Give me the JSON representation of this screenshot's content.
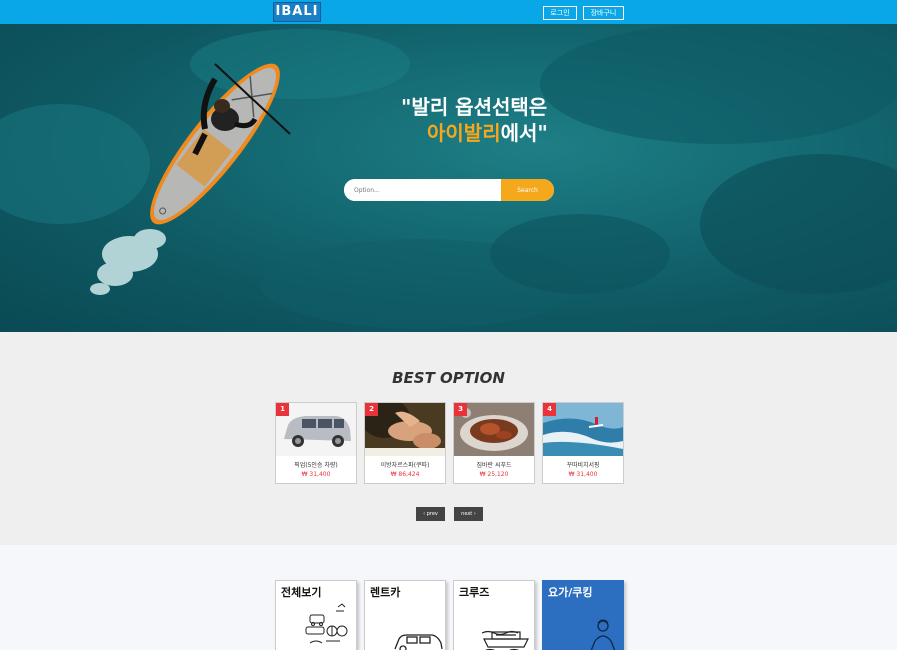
{
  "header": {
    "logo": "IBALI",
    "login_label": "로그인",
    "cart_label": "장바구니",
    "bar_color": "#0aa7e8"
  },
  "hero": {
    "line1": "\"발리 옵션선택은",
    "line2_highlight": "아이발리",
    "line2_rest": "에서\"",
    "highlight_color": "#f6a81c",
    "search": {
      "placeholder": "Option...",
      "button_label": "Search"
    }
  },
  "best": {
    "title": "BEST OPTION",
    "items": [
      {
        "rank": "1",
        "name": "픽업(5인승 차량)",
        "price": "₩ 31,400"
      },
      {
        "rank": "2",
        "name": "이방자르스파(쿠따)",
        "price": "₩ 86,424"
      },
      {
        "rank": "3",
        "name": "짐바란 씨푸드",
        "price": "₩ 25,120"
      },
      {
        "rank": "4",
        "name": "꾸따비치서핑",
        "price": "₩ 31,400"
      }
    ],
    "prev_label": "‹ prev",
    "next_label": "next ›"
  },
  "categories": [
    {
      "label": "전체보기",
      "icon": "vehicles-collage-icon"
    },
    {
      "label": "렌트카",
      "icon": "car-icon"
    },
    {
      "label": "크루즈",
      "icon": "cruise-ship-icon"
    },
    {
      "label": "요가/쿠킹",
      "icon": "yoga-person-icon"
    }
  ],
  "colors": {
    "badge": "#e8333a",
    "price": "#e8333a",
    "category_active": "#2c6ec0"
  }
}
